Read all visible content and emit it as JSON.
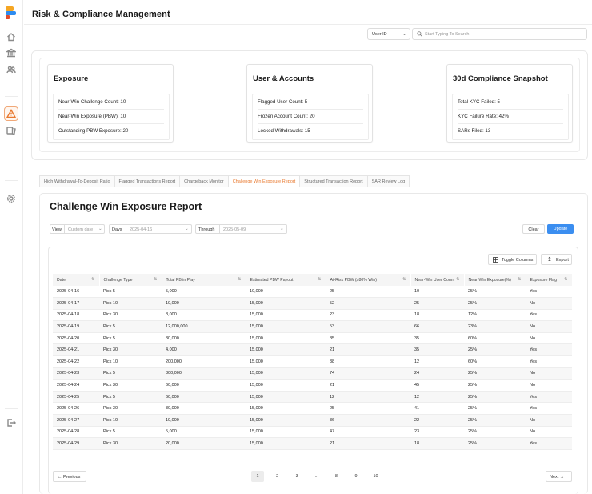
{
  "app": {
    "title": "Risk & Compliance Management"
  },
  "sidebar": {
    "items": [
      {
        "icon": "home-icon"
      },
      {
        "icon": "bank-icon"
      },
      {
        "icon": "users-icon"
      },
      {
        "icon": "warning-icon",
        "active": true
      },
      {
        "icon": "cards-icon"
      },
      {
        "icon": "settings-icon"
      },
      {
        "icon": "logout-icon"
      }
    ]
  },
  "search": {
    "field_value": "User ID",
    "placeholder": "Start Typing To Search"
  },
  "summary": {
    "cards": [
      {
        "title": "Exposure",
        "rows": [
          "Near-Win Challenge Count: 10",
          "Near-Win Exposure (PBW): 10",
          "Outstanding PBW Exposure: 20"
        ]
      },
      {
        "title": "User & Accounts",
        "rows": [
          "Flagged User Count: 5",
          "Frozen Account Count: 20",
          "Locked Withdrawals: 15"
        ]
      },
      {
        "title": "30d Compliance Snapshot",
        "rows": [
          "Total KYC Failed: 5",
          "KYC Failure Rate: 42%",
          "SARs Filed: 13"
        ]
      }
    ]
  },
  "tabs": [
    {
      "label": "High Withdrawal-To-Deposit Ratio",
      "active": false
    },
    {
      "label": "Flagged Transactions Report",
      "active": false
    },
    {
      "label": "Chargeback Monitor",
      "active": false
    },
    {
      "label": "Challenge Win Exposure Report",
      "active": true
    },
    {
      "label": "Structured Transaction Report",
      "active": false
    },
    {
      "label": "SAR Review Log",
      "active": false
    }
  ],
  "report": {
    "title": "Challenge Win Exposure Report",
    "filters": {
      "view_label": "View",
      "view_value": "Custom date",
      "days_label": "Days",
      "days_value": "2025-04-16",
      "through_label": "Through",
      "through_value": "2025-05-09"
    },
    "clear_label": "Clear",
    "update_label": "Update",
    "toggle_columns_label": "Toggle Columns",
    "export_label": "Export",
    "columns": [
      "Date",
      "Challenge Type",
      "Total PB in Play",
      "Estimated PBW Payout",
      "At-Risk PBW (≥80% Win)",
      "Near-Win User Count",
      "Near-Win Exposure(%)",
      "Exposure Flag"
    ],
    "rows": [
      [
        "2025-04-16",
        "Pick 5",
        "5,000",
        "10,000",
        "25",
        "10",
        "25%",
        "Yes"
      ],
      [
        "2025-04-17",
        "Pick 10",
        "10,000",
        "15,000",
        "52",
        "25",
        "25%",
        "No"
      ],
      [
        "2025-04-18",
        "Pick 30",
        "8,000",
        "15,000",
        "23",
        "18",
        "12%",
        "Yes"
      ],
      [
        "2025-04-19",
        "Pick 5",
        "12,000,000",
        "15,000",
        "53",
        "66",
        "23%",
        "No"
      ],
      [
        "2025-04-20",
        "Pick 5",
        "30,000",
        "15,000",
        "85",
        "35",
        "60%",
        "No"
      ],
      [
        "2025-04-21",
        "Pick 30",
        "4,000",
        "15,000",
        "21",
        "35",
        "25%",
        "Yes"
      ],
      [
        "2025-04-22",
        "Pick 10",
        "200,000",
        "15,000",
        "38",
        "12",
        "60%",
        "Yes"
      ],
      [
        "2025-04-23",
        "Pick 5",
        "800,000",
        "15,000",
        "74",
        "24",
        "25%",
        "No"
      ],
      [
        "2025-04-24",
        "Pick 30",
        "60,000",
        "15,000",
        "21",
        "45",
        "25%",
        "No"
      ],
      [
        "2025-04-25",
        "Pick 5",
        "60,000",
        "15,000",
        "12",
        "12",
        "25%",
        "Yes"
      ],
      [
        "2025-04-26",
        "Pick 30",
        "30,000",
        "15,000",
        "25",
        "41",
        "25%",
        "Yes"
      ],
      [
        "2025-04-27",
        "Pick 10",
        "10,000",
        "15,000",
        "36",
        "22",
        "25%",
        "No"
      ],
      [
        "2025-04-28",
        "Pick 5",
        "5,000",
        "15,000",
        "47",
        "23",
        "25%",
        "No"
      ],
      [
        "2025-04-29",
        "Pick 30",
        "20,000",
        "15,000",
        "21",
        "18",
        "25%",
        "Yes"
      ]
    ],
    "pagination": {
      "prev_label": "Previous",
      "next_label": "Next",
      "pages": [
        "1",
        "2",
        "3",
        "...",
        "8",
        "9",
        "10"
      ],
      "current": "1"
    }
  }
}
